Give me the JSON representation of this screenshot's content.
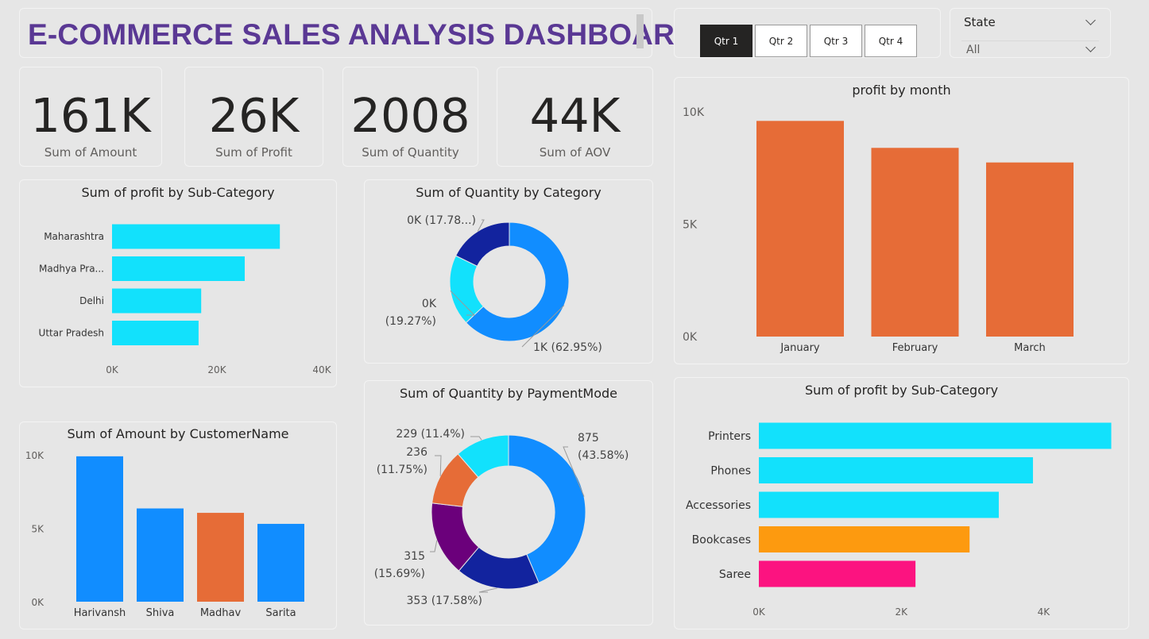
{
  "dashboard": {
    "title": "E-COMMERCE SALES ANALYSIS DASHBOARD"
  },
  "kpis": [
    {
      "value": "161K",
      "label": "Sum of Amount"
    },
    {
      "value": "26K",
      "label": "Sum of Profit"
    },
    {
      "value": "2008",
      "label": "Sum of Quantity"
    },
    {
      "value": "44K",
      "label": "Sum of AOV"
    }
  ],
  "quarter_slicer": {
    "options": [
      "Qtr 1",
      "Qtr 2",
      "Qtr 3",
      "Qtr 4"
    ],
    "selected": "Qtr 1"
  },
  "state_slicer": {
    "title": "State",
    "value": "All"
  },
  "colors": {
    "cyan": "#12e1fc",
    "blue": "#118dff",
    "navy": "#12239e",
    "orange": "#e66c37",
    "purple": "#6b007b",
    "amber": "#fd9a0f",
    "pink": "#fc1380"
  },
  "chart_data": [
    {
      "id": "profit_by_state",
      "type": "bar",
      "orientation": "horizontal",
      "title": "Sum of profit by Sub-Category",
      "categories": [
        "Maharashtra",
        "Madhya Pra...",
        "Delhi",
        "Uttar Pradesh"
      ],
      "values": [
        32000,
        25300,
        17000,
        16500
      ],
      "xlim": [
        0,
        40000
      ],
      "xticks": [
        0,
        20000,
        40000
      ],
      "xtick_labels": [
        "0K",
        "20K",
        "40K"
      ],
      "colors": [
        "#12e1fc",
        "#12e1fc",
        "#12e1fc",
        "#12e1fc"
      ],
      "grid": false
    },
    {
      "id": "quantity_by_category",
      "type": "pie",
      "donut": true,
      "title": "Sum of Quantity by Category",
      "values": [
        62.95,
        19.27,
        17.78
      ],
      "labels": [
        "1K (62.95%)",
        "0K (19.27%)",
        "0K (17.78...)"
      ],
      "label_lines": [
        [
          "1K (62.95%)"
        ],
        [
          "0K",
          "(19.27%)"
        ],
        [
          "0K (17.78...)"
        ]
      ],
      "colors": [
        "#118dff",
        "#12e1fc",
        "#12239e"
      ]
    },
    {
      "id": "profit_by_month",
      "type": "bar",
      "orientation": "vertical",
      "title": "profit by month",
      "categories": [
        "January",
        "February",
        "March"
      ],
      "values": [
        9600,
        8400,
        7750
      ],
      "ylim": [
        0,
        10000
      ],
      "yticks": [
        0,
        5000,
        10000
      ],
      "ytick_labels": [
        "0K",
        "5K",
        "10K"
      ],
      "colors": [
        "#e66c37",
        "#e66c37",
        "#e66c37"
      ],
      "grid": false
    },
    {
      "id": "amount_by_customer",
      "type": "bar",
      "orientation": "vertical",
      "title": "Sum of Amount by CustomerName",
      "categories": [
        "Harivansh",
        "Shiva",
        "Madhav",
        "Sarita"
      ],
      "values": [
        9900,
        6350,
        6050,
        5300
      ],
      "ylim": [
        0,
        10000
      ],
      "yticks": [
        0,
        5000,
        10000
      ],
      "ytick_labels": [
        "0K",
        "5K",
        "10K"
      ],
      "colors": [
        "#118dff",
        "#118dff",
        "#e66c37",
        "#118dff"
      ],
      "grid": false
    },
    {
      "id": "quantity_by_paymentmode",
      "type": "pie",
      "donut": true,
      "title": "Sum of Quantity by PaymentMode",
      "values": [
        875,
        353,
        315,
        236,
        229
      ],
      "percents": [
        "43.58%",
        "17.58%",
        "15.69%",
        "11.75%",
        "11.4%"
      ],
      "labels": [
        "875 (43.58%)",
        "353 (17.58%)",
        "315 (15.69%)",
        "236 (11.75%)",
        "229 (11.4%)"
      ],
      "label_lines": [
        [
          "875",
          "(43.58%)"
        ],
        [
          "353 (17.58%)"
        ],
        [
          "315",
          "(15.69%)"
        ],
        [
          "236",
          "(11.75%)"
        ],
        [
          "229 (11.4%)"
        ]
      ],
      "colors": [
        "#118dff",
        "#12239e",
        "#6b007b",
        "#e66c37",
        "#12e1fc"
      ]
    },
    {
      "id": "profit_by_subcategory",
      "type": "bar",
      "orientation": "horizontal",
      "title": "Sum of profit by Sub-Category",
      "categories": [
        "Printers",
        "Phones",
        "Accessories",
        "Bookcases",
        "Saree"
      ],
      "values": [
        4950,
        3850,
        3370,
        2960,
        2200
      ],
      "xlim": [
        0,
        5000
      ],
      "xticks": [
        0,
        2000,
        4000
      ],
      "xtick_labels": [
        "0K",
        "2K",
        "4K"
      ],
      "colors": [
        "#12e1fc",
        "#12e1fc",
        "#12e1fc",
        "#fd9a0f",
        "#fc1380"
      ],
      "grid": false
    }
  ]
}
